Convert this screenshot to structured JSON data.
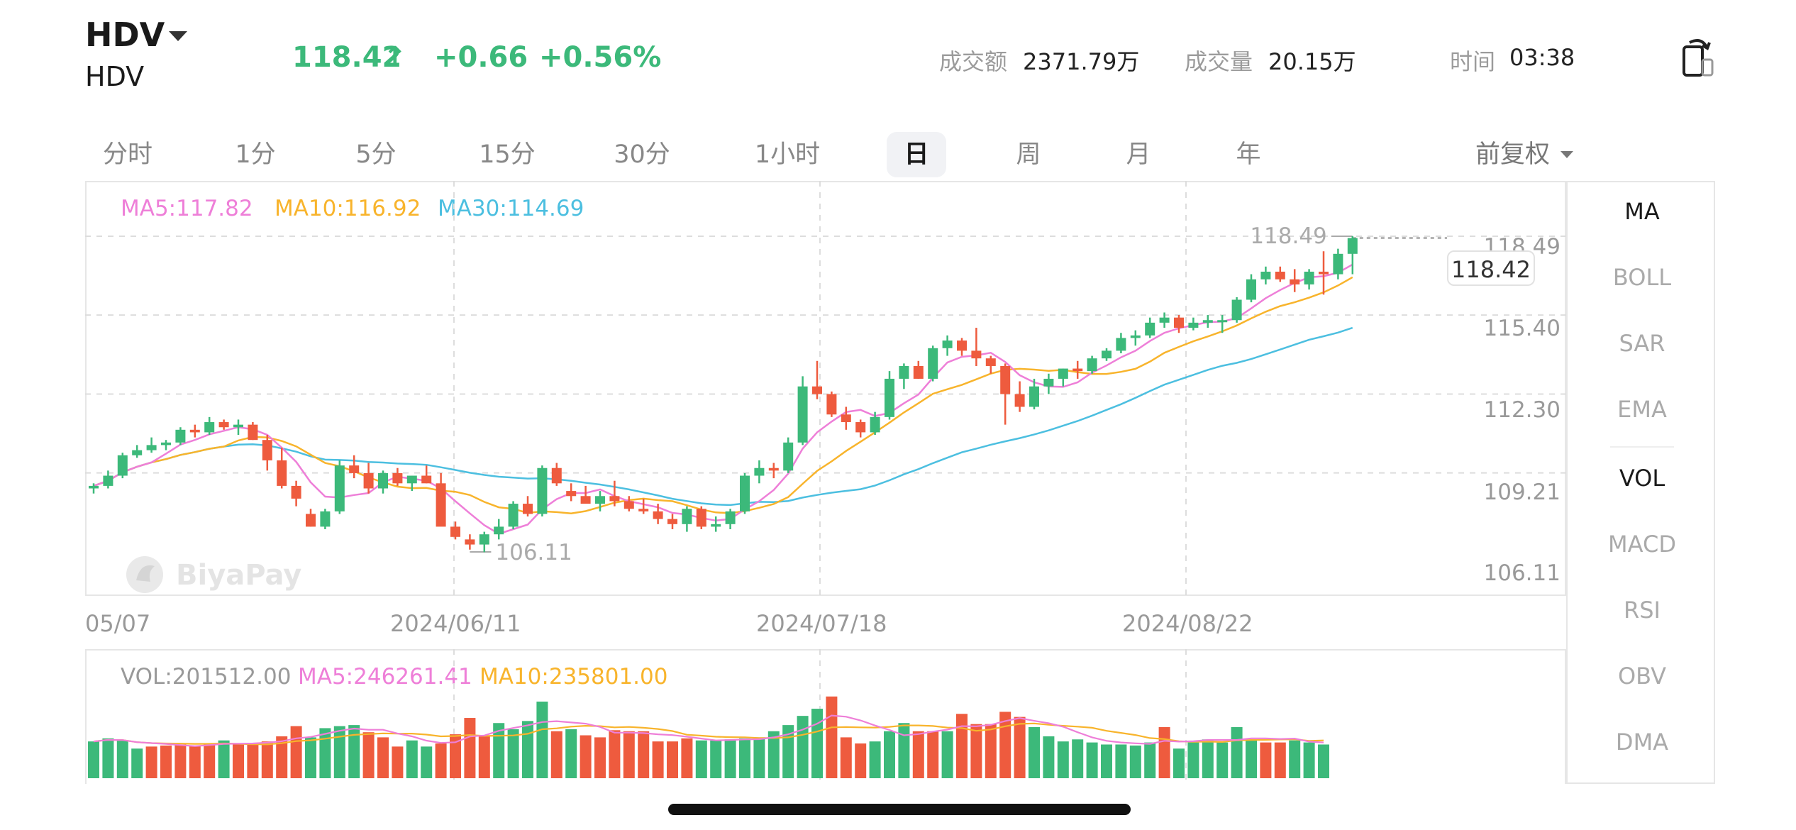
{
  "header": {
    "symbol": "HDV",
    "name": "HDV",
    "price": "118.42",
    "arrow": "↑",
    "change": "+0.66",
    "change_pct": "+0.56%",
    "turnover_label": "成交额",
    "turnover_value": "2371.79万",
    "volume_label": "成交量",
    "volume_value": "20.15万",
    "time_label": "时间",
    "time_value": "03:38",
    "rotate_icon": "rotate-screen-icon"
  },
  "periods": [
    {
      "label": "分时",
      "active": false
    },
    {
      "label": "1分",
      "active": false
    },
    {
      "label": "5分",
      "active": false
    },
    {
      "label": "15分",
      "active": false
    },
    {
      "label": "30分",
      "active": false
    },
    {
      "label": "1小时",
      "active": false
    },
    {
      "label": "日",
      "active": true
    },
    {
      "label": "周",
      "active": false
    },
    {
      "label": "月",
      "active": false
    },
    {
      "label": "年",
      "active": false
    }
  ],
  "adjust": "前复权",
  "ma_legend": {
    "ma5": "MA5:117.82",
    "ma10": "MA10:116.92",
    "ma30": "MA30:114.69"
  },
  "vol_legend": {
    "vol": "VOL:201512.00",
    "ma5": "MA5:246261.41",
    "ma10": "MA10:235801.00"
  },
  "dates": [
    "05/07",
    "2024/06/11",
    "2024/07/18",
    "2024/08/22"
  ],
  "price_axis": [
    "118.49",
    "115.40",
    "112.30",
    "109.21",
    "106.11"
  ],
  "current_price_tag": "118.42",
  "high_label": "118.49",
  "low_label": "106.11",
  "watermark": "BiyaPay",
  "side_indicators": [
    {
      "label": "MA",
      "active": true
    },
    {
      "label": "BOLL",
      "active": false
    },
    {
      "label": "SAR",
      "active": false
    },
    {
      "label": "EMA",
      "active": false
    },
    {
      "label": "VOL",
      "active": true
    },
    {
      "label": "MACD",
      "active": false
    },
    {
      "label": "RSI",
      "active": false
    },
    {
      "label": "OBV",
      "active": false
    },
    {
      "label": "DMA",
      "active": false
    }
  ],
  "colors": {
    "up": "#3cb97a",
    "down": "#ee5b3e",
    "ma5": "#ee7fd8",
    "ma10": "#f8b42c",
    "ma30": "#4cbfe0"
  },
  "chart_data": {
    "type": "candlestick",
    "y_axis_ticks": [
      118.49,
      115.4,
      112.3,
      109.21,
      106.11
    ],
    "ylim": [
      106.11,
      118.49
    ],
    "candles": [
      [
        108.6,
        108.8,
        108.4,
        108.7
      ],
      [
        108.7,
        109.3,
        108.6,
        109.1
      ],
      [
        109.1,
        110.0,
        109.0,
        109.9
      ],
      [
        109.9,
        110.3,
        109.8,
        110.1
      ],
      [
        110.1,
        110.6,
        110.0,
        110.3
      ],
      [
        110.3,
        110.5,
        110.1,
        110.4
      ],
      [
        110.4,
        111.0,
        110.3,
        110.9
      ],
      [
        110.9,
        111.1,
        110.6,
        110.8
      ],
      [
        110.8,
        111.4,
        110.7,
        111.2
      ],
      [
        111.2,
        111.3,
        110.9,
        111.0
      ],
      [
        111.0,
        111.3,
        110.7,
        111.1
      ],
      [
        111.1,
        111.2,
        110.5,
        110.5
      ],
      [
        110.5,
        110.7,
        109.3,
        109.7
      ],
      [
        109.7,
        110.2,
        108.6,
        108.7
      ],
      [
        108.7,
        108.9,
        107.9,
        108.2
      ],
      [
        107.6,
        107.8,
        107.1,
        107.1
      ],
      [
        107.1,
        107.8,
        107.0,
        107.7
      ],
      [
        107.7,
        109.7,
        107.6,
        109.5
      ],
      [
        109.5,
        109.9,
        109.0,
        109.2
      ],
      [
        109.2,
        109.6,
        108.4,
        108.6
      ],
      [
        108.6,
        109.3,
        108.4,
        109.2
      ],
      [
        109.2,
        109.4,
        108.7,
        108.8
      ],
      [
        108.8,
        109.1,
        108.5,
        109.1
      ],
      [
        109.1,
        109.5,
        108.8,
        108.8
      ],
      [
        108.8,
        109.2,
        107.3,
        107.1
      ],
      [
        107.1,
        107.3,
        106.6,
        106.7
      ],
      [
        106.6,
        106.8,
        106.2,
        106.4
      ],
      [
        106.4,
        106.9,
        106.1,
        106.8
      ],
      [
        106.8,
        107.4,
        106.6,
        107.1
      ],
      [
        107.1,
        108.1,
        107.0,
        108.0
      ],
      [
        108.0,
        108.3,
        107.5,
        107.6
      ],
      [
        107.6,
        109.5,
        107.5,
        109.4
      ],
      [
        109.4,
        109.6,
        108.7,
        108.8
      ],
      [
        108.5,
        108.8,
        108.1,
        108.3
      ],
      [
        108.3,
        108.7,
        108.2,
        108.0
      ],
      [
        108.0,
        108.5,
        107.7,
        108.3
      ],
      [
        108.3,
        108.9,
        107.9,
        108.1
      ],
      [
        108.1,
        108.3,
        107.7,
        107.8
      ],
      [
        107.8,
        108.2,
        107.6,
        107.7
      ],
      [
        107.7,
        108.0,
        107.2,
        107.4
      ],
      [
        107.4,
        107.6,
        107.0,
        107.2
      ],
      [
        107.2,
        107.9,
        106.9,
        107.8
      ],
      [
        107.8,
        107.9,
        107.0,
        107.1
      ],
      [
        107.1,
        107.5,
        106.9,
        107.2
      ],
      [
        107.2,
        107.8,
        107.0,
        107.7
      ],
      [
        107.7,
        109.2,
        107.6,
        109.1
      ],
      [
        109.1,
        109.7,
        108.8,
        109.4
      ],
      [
        109.4,
        109.6,
        109.0,
        109.3
      ],
      [
        109.3,
        110.6,
        109.2,
        110.4
      ],
      [
        110.4,
        113.0,
        110.3,
        112.6
      ],
      [
        112.6,
        113.6,
        112.1,
        112.3
      ],
      [
        112.3,
        112.4,
        111.4,
        111.5
      ],
      [
        111.5,
        111.8,
        110.9,
        111.2
      ],
      [
        111.2,
        111.3,
        110.6,
        110.8
      ],
      [
        110.8,
        111.6,
        110.7,
        111.4
      ],
      [
        111.4,
        113.2,
        111.3,
        112.9
      ],
      [
        112.9,
        113.5,
        112.5,
        113.4
      ],
      [
        113.4,
        113.6,
        112.9,
        112.9
      ],
      [
        112.9,
        114.2,
        112.8,
        114.1
      ],
      [
        114.1,
        114.6,
        113.8,
        114.4
      ],
      [
        114.4,
        114.5,
        113.8,
        114.0
      ],
      [
        114.0,
        114.9,
        113.4,
        113.7
      ],
      [
        113.7,
        113.8,
        113.1,
        113.4
      ],
      [
        113.4,
        113.5,
        111.1,
        112.3
      ],
      [
        112.3,
        112.8,
        111.6,
        111.8
      ],
      [
        111.8,
        112.9,
        111.7,
        112.6
      ],
      [
        112.6,
        113.1,
        112.3,
        112.9
      ],
      [
        112.9,
        113.3,
        112.6,
        113.3
      ],
      [
        113.3,
        113.6,
        112.9,
        113.2
      ],
      [
        113.2,
        113.8,
        113.1,
        113.7
      ],
      [
        113.7,
        114.1,
        113.6,
        114.0
      ],
      [
        114.0,
        114.7,
        113.9,
        114.5
      ],
      [
        114.5,
        114.8,
        114.2,
        114.6
      ],
      [
        114.6,
        115.3,
        114.5,
        115.1
      ],
      [
        115.1,
        115.5,
        114.9,
        115.3
      ],
      [
        115.3,
        115.4,
        114.7,
        114.9
      ],
      [
        114.9,
        115.3,
        114.8,
        115.1
      ],
      [
        115.1,
        115.4,
        114.9,
        115.2
      ],
      [
        115.2,
        115.4,
        114.7,
        115.2
      ],
      [
        115.2,
        116.1,
        115.1,
        116.0
      ],
      [
        116.0,
        117.0,
        115.9,
        116.8
      ],
      [
        116.8,
        117.3,
        116.6,
        117.1
      ],
      [
        117.1,
        117.3,
        116.7,
        116.8
      ],
      [
        116.8,
        117.2,
        116.3,
        116.6
      ],
      [
        116.6,
        117.2,
        116.4,
        117.1
      ],
      [
        117.1,
        117.9,
        116.2,
        117.0
      ],
      [
        117.0,
        118.0,
        116.8,
        117.8
      ],
      [
        117.8,
        118.49,
        117.0,
        118.42
      ]
    ],
    "ma_series": [
      "MA5",
      "MA10",
      "MA30"
    ],
    "volume": [
      {
        "v": 72,
        "up": true
      },
      {
        "v": 78,
        "up": true
      },
      {
        "v": 74,
        "up": true
      },
      {
        "v": 58,
        "up": true
      },
      {
        "v": 62,
        "up": false
      },
      {
        "v": 64,
        "up": false
      },
      {
        "v": 66,
        "up": false
      },
      {
        "v": 64,
        "up": false
      },
      {
        "v": 68,
        "up": false
      },
      {
        "v": 74,
        "up": true
      },
      {
        "v": 66,
        "up": false
      },
      {
        "v": 68,
        "up": false
      },
      {
        "v": 72,
        "up": false
      },
      {
        "v": 82,
        "up": false
      },
      {
        "v": 102,
        "up": false
      },
      {
        "v": 80,
        "up": true
      },
      {
        "v": 98,
        "up": true
      },
      {
        "v": 102,
        "up": true
      },
      {
        "v": 104,
        "up": true
      },
      {
        "v": 90,
        "up": false
      },
      {
        "v": 80,
        "up": false
      },
      {
        "v": 62,
        "up": false
      },
      {
        "v": 74,
        "up": true
      },
      {
        "v": 62,
        "up": true
      },
      {
        "v": 68,
        "up": false
      },
      {
        "v": 86,
        "up": false
      },
      {
        "v": 118,
        "up": false
      },
      {
        "v": 84,
        "up": false
      },
      {
        "v": 108,
        "up": true
      },
      {
        "v": 96,
        "up": true
      },
      {
        "v": 112,
        "up": true
      },
      {
        "v": 150,
        "up": true
      },
      {
        "v": 92,
        "up": false
      },
      {
        "v": 96,
        "up": true
      },
      {
        "v": 84,
        "up": false
      },
      {
        "v": 80,
        "up": false
      },
      {
        "v": 94,
        "up": false
      },
      {
        "v": 92,
        "up": false
      },
      {
        "v": 92,
        "up": false
      },
      {
        "v": 72,
        "up": false
      },
      {
        "v": 72,
        "up": false
      },
      {
        "v": 78,
        "up": false
      },
      {
        "v": 74,
        "up": true
      },
      {
        "v": 74,
        "up": true
      },
      {
        "v": 76,
        "up": true
      },
      {
        "v": 78,
        "up": true
      },
      {
        "v": 80,
        "up": true
      },
      {
        "v": 92,
        "up": true
      },
      {
        "v": 104,
        "up": true
      },
      {
        "v": 122,
        "up": true
      },
      {
        "v": 136,
        "up": true
      },
      {
        "v": 160,
        "up": false
      },
      {
        "v": 80,
        "up": false
      },
      {
        "v": 68,
        "up": false
      },
      {
        "v": 72,
        "up": true
      },
      {
        "v": 92,
        "up": true
      },
      {
        "v": 108,
        "up": true
      },
      {
        "v": 92,
        "up": false
      },
      {
        "v": 92,
        "up": false
      },
      {
        "v": 92,
        "up": true
      },
      {
        "v": 126,
        "up": false
      },
      {
        "v": 106,
        "up": false
      },
      {
        "v": 106,
        "up": false
      },
      {
        "v": 130,
        "up": false
      },
      {
        "v": 120,
        "up": false
      },
      {
        "v": 100,
        "up": true
      },
      {
        "v": 82,
        "up": true
      },
      {
        "v": 72,
        "up": true
      },
      {
        "v": 76,
        "up": true
      },
      {
        "v": 70,
        "up": true
      },
      {
        "v": 66,
        "up": true
      },
      {
        "v": 66,
        "up": true
      },
      {
        "v": 64,
        "up": true
      },
      {
        "v": 70,
        "up": true
      },
      {
        "v": 100,
        "up": false
      },
      {
        "v": 58,
        "up": true
      },
      {
        "v": 70,
        "up": true
      },
      {
        "v": 76,
        "up": true
      },
      {
        "v": 70,
        "up": true
      },
      {
        "v": 100,
        "up": true
      },
      {
        "v": 74,
        "up": true
      },
      {
        "v": 70,
        "up": false
      },
      {
        "v": 70,
        "up": false
      },
      {
        "v": 74,
        "up": true
      },
      {
        "v": 70,
        "up": true
      },
      {
        "v": 66,
        "up": true
      }
    ]
  }
}
